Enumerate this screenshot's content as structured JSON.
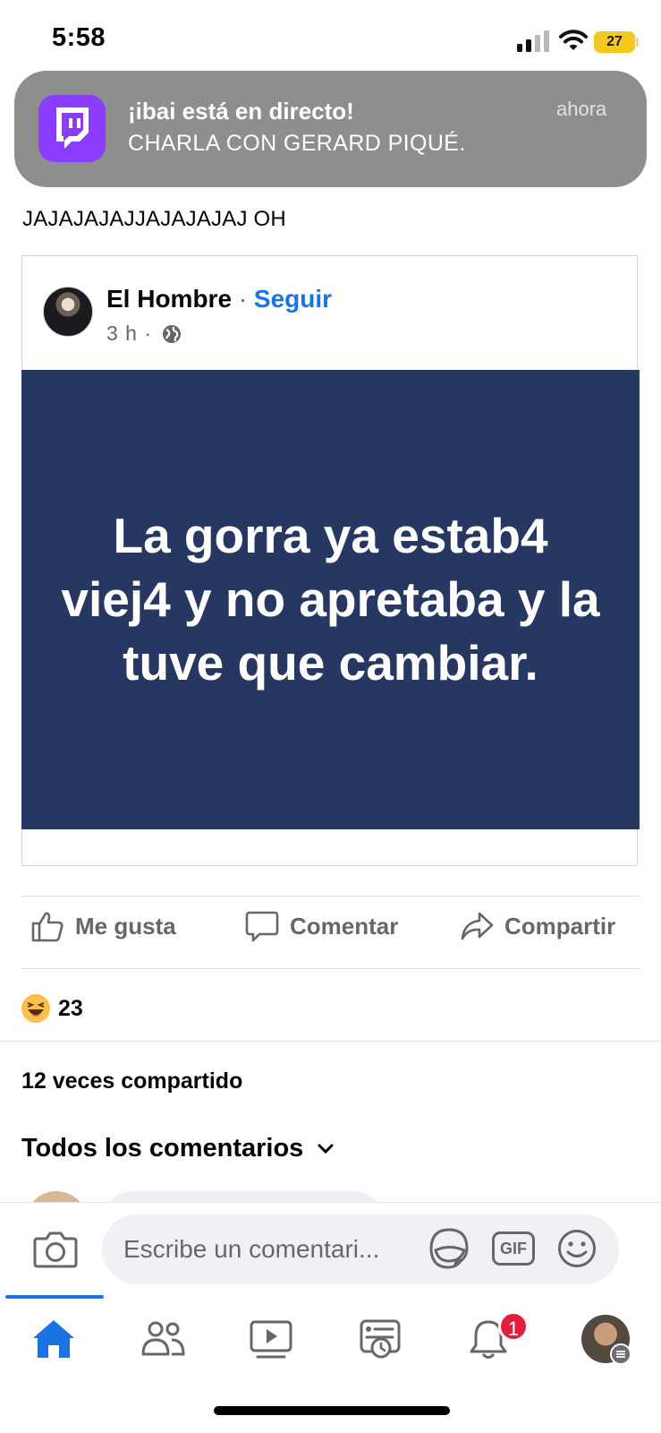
{
  "status_bar": {
    "time": "5:58",
    "battery_level": "27",
    "battery_color": "#f4c91e"
  },
  "notification": {
    "app_icon": "twitch-icon",
    "title": "¡ibai está en directo!",
    "body": "CHARLA CON GERARD PIQUÉ.",
    "time": "ahora"
  },
  "post": {
    "caption": "JAJAJAJAJJAJAJAJAJ OH",
    "shared": {
      "author": "El Hombre",
      "separator": " · ",
      "follow_label": "Seguir",
      "time": "3 h ·",
      "audience_icon": "globe-icon",
      "image_text": "La gorra ya estab4 viej4 y no apretaba y la tuve que cambiar.",
      "image_background": "#263762"
    },
    "actions": {
      "like": "Me gusta",
      "comment": "Comentar",
      "share": "Compartir"
    },
    "reactions": {
      "icon": "haha-reaction-icon",
      "count": "23"
    },
    "shares": "12 veces compartido",
    "comments_filter": "Todos los comentarios"
  },
  "composer": {
    "placeholder": "Escribe un comentari...",
    "gif_label": "GIF"
  },
  "bottom_nav": {
    "items": [
      "home-icon",
      "friends-icon",
      "video-icon",
      "feeds-icon",
      "notifications-icon",
      "profile-avatar"
    ],
    "active": "home-icon",
    "notification_badge": "1",
    "accent": "#1b74e4"
  }
}
